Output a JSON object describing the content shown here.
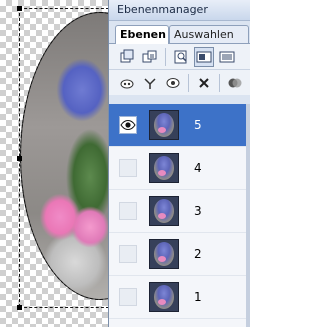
{
  "panel": {
    "title": "Ebenenmanager",
    "tabs": [
      {
        "label": "Ebenen",
        "active": true
      },
      {
        "label": "Auswahlen",
        "active": false
      }
    ]
  },
  "toolbar_row1": [
    "new-layer-icon",
    "duplicate-layer-icon",
    "layer-properties-icon",
    "layer-thumbnail-view-icon",
    "layer-list-view-icon"
  ],
  "toolbar_row2": [
    "lock-icon",
    "merge-icon",
    "mask-icon",
    "delete-icon",
    "blend-mode-icon"
  ],
  "layers": [
    {
      "name": "5",
      "visible": true,
      "selected": true
    },
    {
      "name": "4",
      "visible": false,
      "selected": false
    },
    {
      "name": "3",
      "visible": false,
      "selected": false
    },
    {
      "name": "2",
      "visible": false,
      "selected": false
    },
    {
      "name": "1",
      "visible": false,
      "selected": false
    }
  ],
  "colors": {
    "selection": "#3d72c8",
    "panel_bg": "#dbe4f1"
  }
}
